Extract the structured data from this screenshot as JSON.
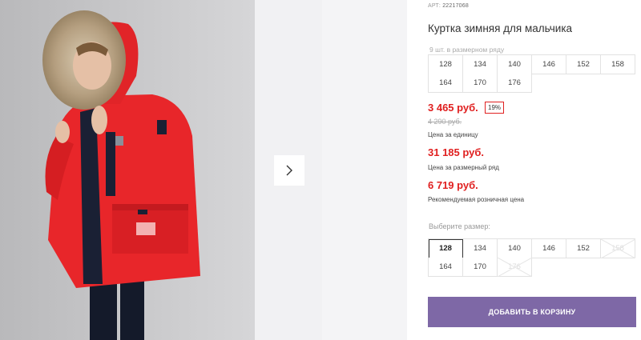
{
  "gallery": {
    "next_icon": "chevron-right-icon"
  },
  "product": {
    "article_label": "АРТ:",
    "article_number": "22217068",
    "title": "Куртка зимняя для мальчика",
    "size_row_hint": "9 шт. в размерном ряду",
    "size_row": [
      "128",
      "134",
      "140",
      "146",
      "152",
      "158",
      "164",
      "170",
      "176"
    ]
  },
  "pricing": {
    "unit_price": "3 465 руб.",
    "discount": "19%",
    "old_price": "4 290 руб.",
    "unit_caption": "Цена за единицу",
    "row_price": "31 185 руб.",
    "row_caption": "Цена за размерный ряд",
    "retail_price": "6 719 руб.",
    "retail_caption": "Рекомендуемая розничная цена"
  },
  "size_select": {
    "label": "Выберите размер:",
    "options": [
      {
        "size": "128",
        "state": "selected"
      },
      {
        "size": "134",
        "state": "available"
      },
      {
        "size": "140",
        "state": "available"
      },
      {
        "size": "146",
        "state": "available"
      },
      {
        "size": "152",
        "state": "available"
      },
      {
        "size": "158",
        "state": "unavailable"
      },
      {
        "size": "164",
        "state": "available"
      },
      {
        "size": "170",
        "state": "available"
      },
      {
        "size": "176",
        "state": "unavailable"
      }
    ]
  },
  "cart": {
    "add_label": "ДОБАВИТЬ В КОРЗИНУ"
  },
  "colors": {
    "price_red": "#e02020",
    "button_purple": "#7e68a6",
    "jacket_red": "#e8262a"
  }
}
